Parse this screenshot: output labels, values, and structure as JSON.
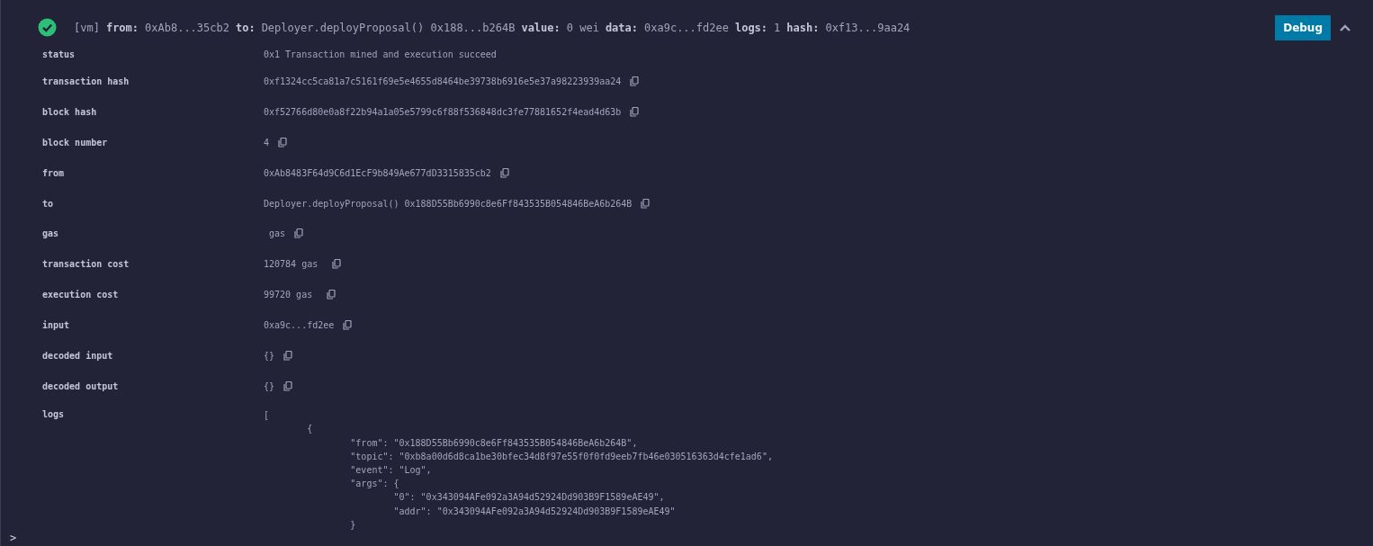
{
  "transaction": {
    "success": true,
    "expanded": true,
    "summary": [
      {
        "kind": "plain",
        "value": "[vm]"
      },
      {
        "kind": "pair",
        "key": "from:",
        "value": "0xAb8...35cb2"
      },
      {
        "kind": "pair",
        "key": "to:",
        "value": "Deployer.deployProposal() 0x188...b264B"
      },
      {
        "kind": "pair",
        "key": "value:",
        "value": "0 wei"
      },
      {
        "kind": "pair",
        "key": "data:",
        "value": "0xa9c...fd2ee"
      },
      {
        "kind": "pair",
        "key": "logs:",
        "value": "1"
      },
      {
        "kind": "pair",
        "key": "hash:",
        "value": "0xf13...9aa24"
      }
    ],
    "debug_button": "Debug",
    "details": [
      {
        "label": "status",
        "value": "0x1 Transaction mined and execution succeed",
        "copy": false
      },
      {
        "label": "transaction hash",
        "value": "0xf1324cc5ca81a7c5161f69e5e4655d8464be39738b6916e5e37a98223939aa24",
        "copy": true
      },
      {
        "label": "block hash",
        "value": "0xf52766d80e0a8f22b94a1a05e5799c6f88f536848dc3fe77881652f4ead4d63b",
        "copy": true
      },
      {
        "label": "block number",
        "value": "4",
        "copy": true
      },
      {
        "label": "from",
        "value": "0xAb8483F64d9C6d1EcF9b849Ae677dD3315835cb2",
        "copy": true
      },
      {
        "label": "to",
        "value": "Deployer.deployProposal() 0x188D55Bb6990c8e6Ff843535B054846BeA6b264B",
        "copy": true
      },
      {
        "label": "gas",
        "value": " gas",
        "copy": true
      },
      {
        "label": "transaction cost",
        "value": "120784 gas ",
        "copy": true
      },
      {
        "label": "execution cost",
        "value": "99720 gas ",
        "copy": true
      },
      {
        "label": "input",
        "value": "0xa9c...fd2ee",
        "copy": true
      },
      {
        "label": "decoded input",
        "value": "{}",
        "copy": true
      },
      {
        "label": "decoded output",
        "value": "{}",
        "copy": true
      }
    ],
    "logs": {
      "label": "logs",
      "lines": [
        "[",
        "\t{",
        "\t\t\"from\": \"0x188D55Bb6990c8e6Ff843535B054846BeA6b264B\",",
        "\t\t\"topic\": \"0xb8a00d6d8ca1be30bfec34d8f97e55f0f0fd9eeb7fb46e030516363d4cfe1ad6\",",
        "\t\t\"event\": \"Log\",",
        "\t\t\"args\": {",
        "\t\t\t\"0\": \"0x343094AFe092a3A94d52924Dd903B9F1589eAE49\",",
        "\t\t\t\"addr\": \"0x343094AFe092a3A94d52924Dd903B9F1589eAE49\"",
        "\t\t}"
      ]
    }
  },
  "prompt": ">"
}
